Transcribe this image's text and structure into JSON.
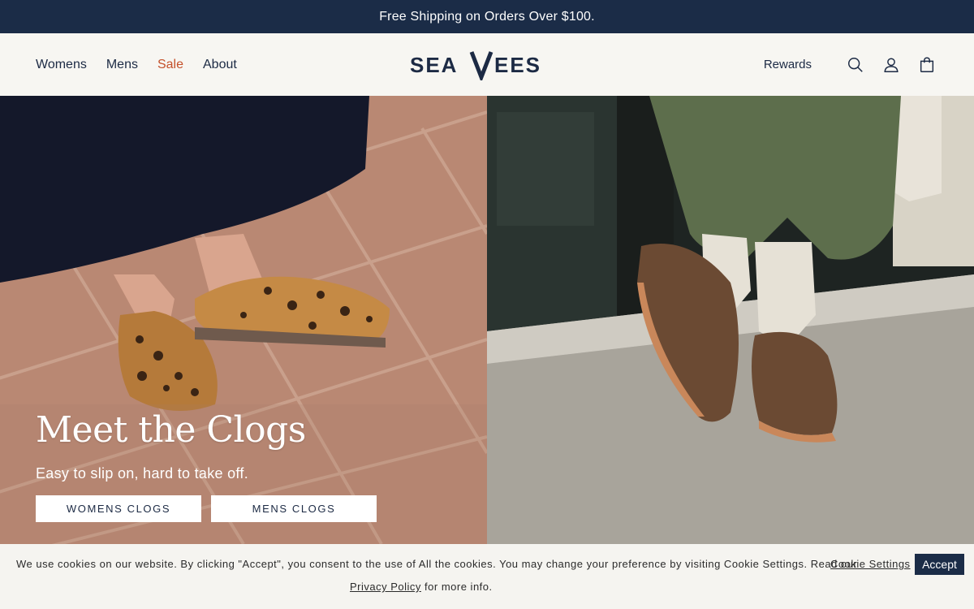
{
  "announcement": "Free Shipping on Orders Over $100.",
  "nav": {
    "items": [
      {
        "label": "Womens"
      },
      {
        "label": "Mens"
      },
      {
        "label": "Sale"
      },
      {
        "label": "About"
      }
    ]
  },
  "brand": {
    "logo_text": "SEAVEES"
  },
  "utility": {
    "rewards_label": "Rewards",
    "icons": [
      "search-icon",
      "account-icon",
      "cart-icon"
    ]
  },
  "hero": {
    "title": "Meet the Clogs",
    "subtitle": "Easy to slip on, hard to take off.",
    "buttons": [
      "WOMENS CLOGS",
      "MENS CLOGS"
    ]
  },
  "cookie_banner": {
    "text_before": "We use cookies on our website. By clicking \"Accept\", you consent to the use of All the cookies. You may change your preference by visiting Cookie Settings. Read our",
    "settings_link": "Cookie Settings",
    "policy_link": "Privacy Policy",
    "text_after": "for more info.",
    "accept_label": "Accept"
  },
  "colors": {
    "navy": "#1b2c47",
    "sale": "#c4502a",
    "background": "#f7f6f2"
  }
}
